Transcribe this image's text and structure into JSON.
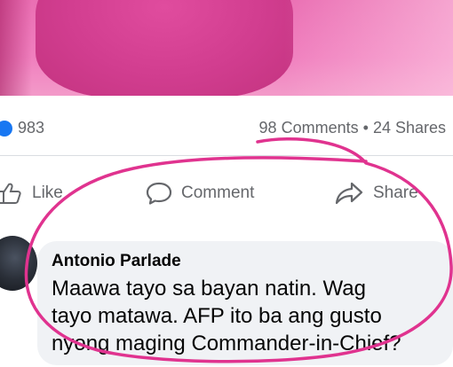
{
  "post": {
    "reactions_count": "983",
    "comments_label": "98 Comments",
    "separator": "•",
    "shares_label": "24 Shares"
  },
  "actions": {
    "like_label": "Like",
    "comment_label": "Comment",
    "share_label": "Share"
  },
  "comment": {
    "author": "Antonio Parlade",
    "lines": [
      "Maawa tayo sa bayan natin. Wag",
      "tayo matawa. AFP ito ba ang gusto",
      "nyong maging Commander-in-Chief?"
    ]
  },
  "colors": {
    "annotation": "#e0338f",
    "like_blue": "#1877f2",
    "muted_text": "#65676b",
    "bubble_bg": "#f0f2f5"
  },
  "icons": [
    "like-reaction-icon",
    "thumbs-up-icon",
    "comment-icon",
    "share-icon"
  ]
}
